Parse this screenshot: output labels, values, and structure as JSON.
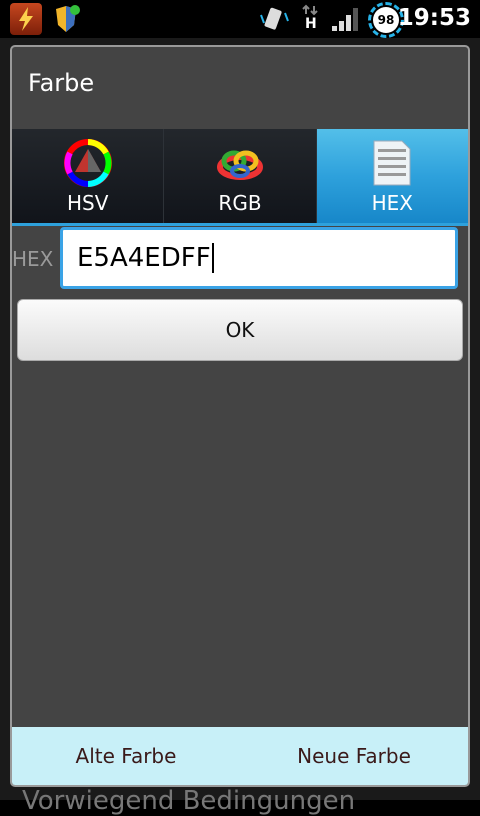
{
  "status_bar": {
    "time": "19:53",
    "battery_level": "98",
    "network_type": "H"
  },
  "dialog": {
    "title": "Farbe",
    "tabs": [
      {
        "label": "HSV",
        "icon": "hsv-color-wheel-icon",
        "active": false
      },
      {
        "label": "RGB",
        "icon": "rgb-rings-icon",
        "active": false
      },
      {
        "label": "HEX",
        "icon": "hex-table-icon",
        "active": true
      }
    ],
    "hex_field_label": "HEX",
    "hex_value": "E5A4EDFF",
    "ok_label": "OK",
    "old_color_label": "Alte Farbe",
    "new_color_label": "Neue Farbe",
    "preview_color": "#c8f0f8",
    "accent_color": "#2ea1dc"
  },
  "background": {
    "partial_text": "Vorwiegend Bedingungen"
  }
}
